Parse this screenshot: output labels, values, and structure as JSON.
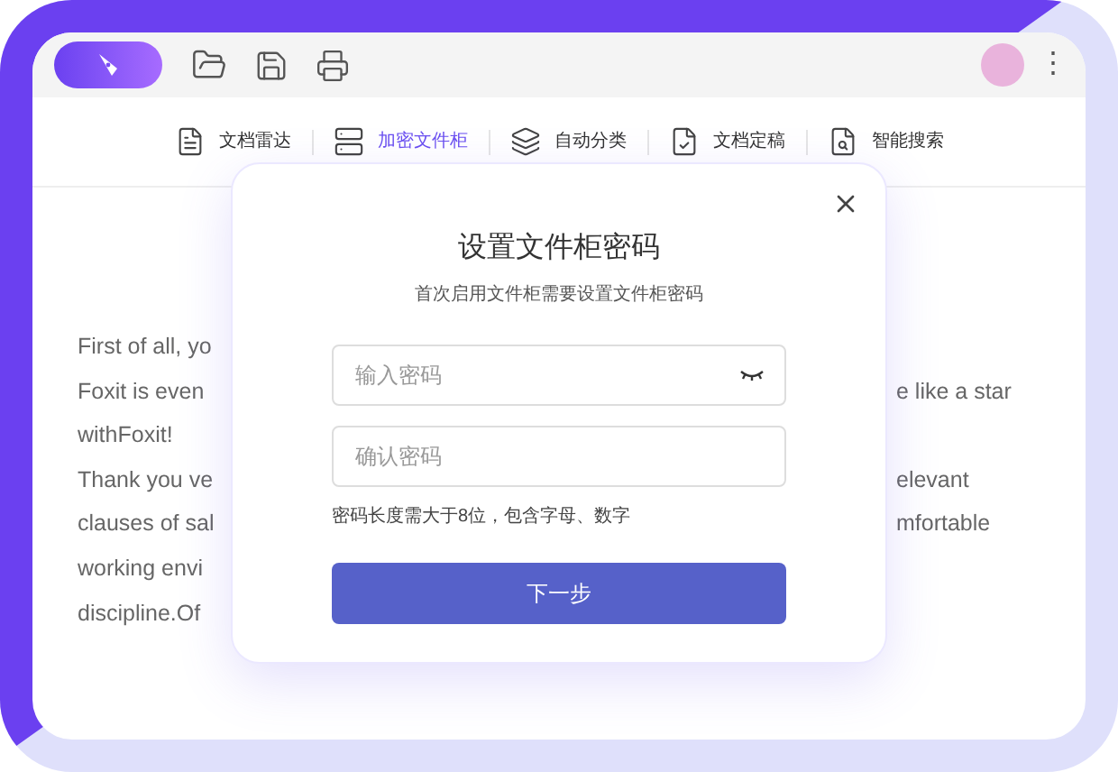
{
  "toolbar": {
    "menu_glyph": "⋮"
  },
  "tabs": [
    {
      "label": "文档雷达",
      "kind": "radar",
      "selected": false
    },
    {
      "label": "加密文件柜",
      "kind": "cabinet",
      "selected": true
    },
    {
      "label": "自动分类",
      "kind": "layers",
      "selected": false
    },
    {
      "label": "文档定稿",
      "kind": "check",
      "selected": false
    },
    {
      "label": "智能搜索",
      "kind": "search",
      "selected": false
    }
  ],
  "document": {
    "lines": [
      {
        "left": "First of all, yo"
      },
      {
        "left": "Foxit is even",
        "right": "e like a star"
      },
      {
        "left": "withFoxit!"
      },
      {
        "left": "Thank you ve",
        "right": "elevant"
      },
      {
        "left": "clauses of sal",
        "right": "mfortable"
      },
      {
        "left": "working envi"
      },
      {
        "left": "discipline.Of"
      }
    ]
  },
  "dialog": {
    "title": "设置文件柜密码",
    "subtitle": "首次启用文件柜需要设置文件柜密码",
    "fields": [
      {
        "placeholder": "输入密码",
        "password_toggle": true
      },
      {
        "placeholder": "确认密码",
        "password_toggle": false
      }
    ],
    "hint": "密码长度需大于8位，包含字母、数字",
    "button": "下一步"
  }
}
